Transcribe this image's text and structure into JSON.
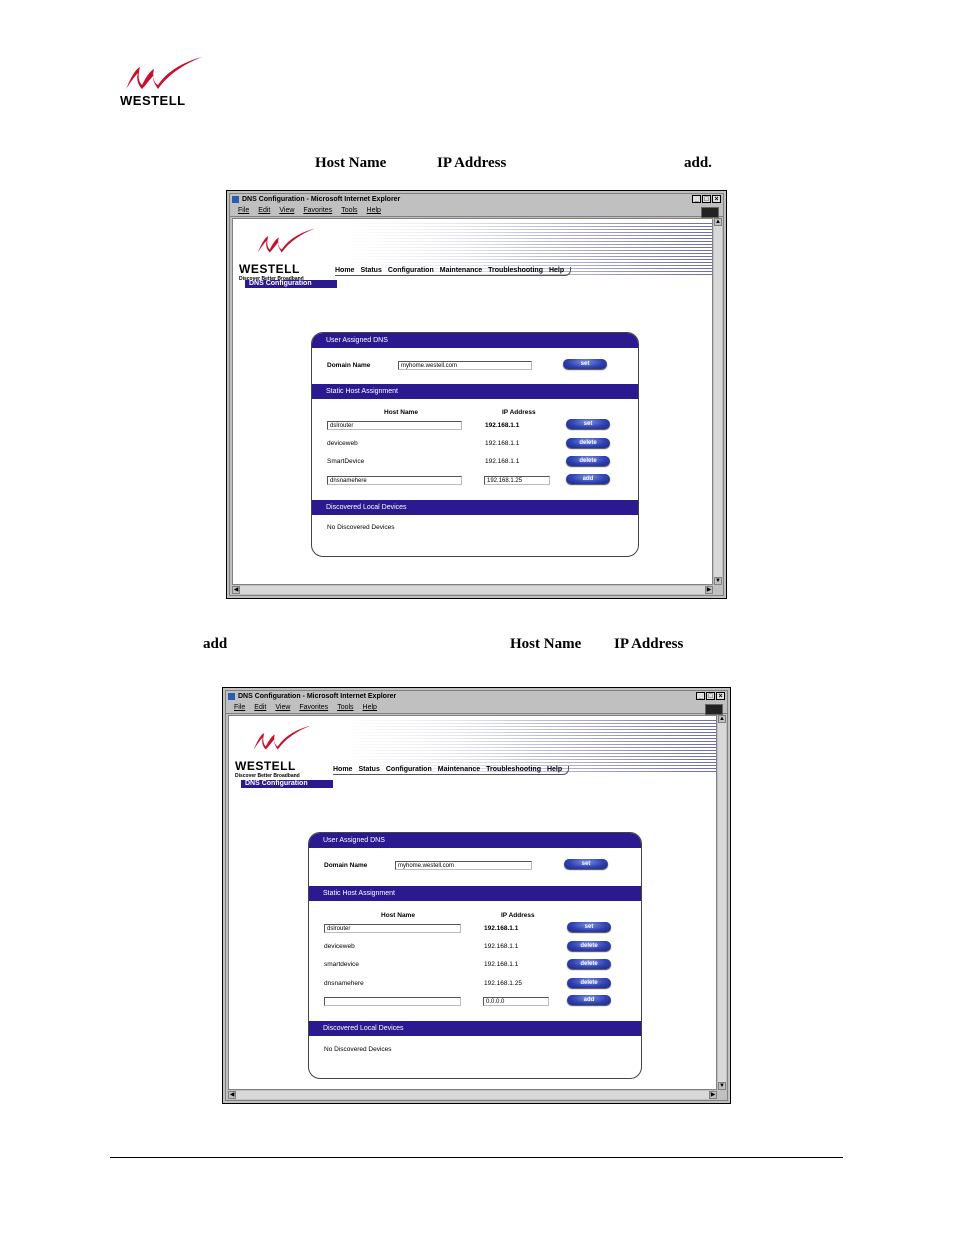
{
  "doc": {
    "logo_text": "WESTELL",
    "intro": {
      "host_name": "Host Name",
      "ip_address": "IP Address",
      "add": "add."
    },
    "para": {
      "add": "add",
      "host_name": "Host Name",
      "ip_address": "IP Address"
    }
  },
  "screen1": {
    "window_title": "DNS Configuration - Microsoft Internet Explorer",
    "menu": [
      "File",
      "Edit",
      "View",
      "Favorites",
      "Tools",
      "Help"
    ],
    "brand": {
      "name": "WESTELL",
      "tagline": "Discover  Better  Broadband"
    },
    "nav": [
      "Home",
      "Status",
      "Configuration",
      "Maintenance",
      "Troubleshooting",
      "Help"
    ],
    "page_title": "DNS Configuration",
    "user_dns": {
      "heading": "User Assigned DNS",
      "domain_label": "Domain Name",
      "domain_value": "myhome.westell.com",
      "set_label": "set"
    },
    "static": {
      "heading": "Static Host Assignment",
      "col_host": "Host Name",
      "col_ip": "IP Address",
      "rows": [
        {
          "host": "dslrouter",
          "ip": "192.168.1.1",
          "button": "set"
        },
        {
          "host": "deviceweb",
          "ip": "192.168.1.1",
          "button": "delete"
        },
        {
          "host": "SmartDevice",
          "ip": "192.168.1.1",
          "button": "delete"
        },
        {
          "host": "dnsnamehere",
          "ip": "192.168.1.25",
          "button": "add"
        }
      ]
    },
    "discovered": {
      "heading": "Discovered Local Devices",
      "text": "No Discovered Devices"
    }
  },
  "screen2": {
    "window_title": "DNS Configuration - Microsoft Internet Explorer",
    "menu": [
      "File",
      "Edit",
      "View",
      "Favorites",
      "Tools",
      "Help"
    ],
    "brand": {
      "name": "WESTELL",
      "tagline": "Discover  Better  Broadband"
    },
    "nav": [
      "Home",
      "Status",
      "Configuration",
      "Maintenance",
      "Troubleshooting",
      "Help"
    ],
    "page_title": "DNS Configuration",
    "user_dns": {
      "heading": "User Assigned DNS",
      "domain_label": "Domain Name",
      "domain_value": "myhome.westell.com",
      "set_label": "set"
    },
    "static": {
      "heading": "Static Host Assignment",
      "col_host": "Host Name",
      "col_ip": "IP Address",
      "rows": [
        {
          "host": "dslrouter",
          "ip": "192.168.1.1",
          "button": "set"
        },
        {
          "host": "deviceweb",
          "ip": "192.168.1.1",
          "button": "delete"
        },
        {
          "host": "smartdevice",
          "ip": "192.168.1.1",
          "button": "delete"
        },
        {
          "host": "dnsnamehere",
          "ip": "192.168.1.25",
          "button": "delete"
        },
        {
          "host": "",
          "ip": "0.0.0.0",
          "button": "add"
        }
      ]
    },
    "discovered": {
      "heading": "Discovered Local Devices",
      "text": "No Discovered Devices"
    }
  },
  "colors": {
    "band": "#2b1a8f",
    "button": "#3042b3",
    "logo_red": "#c8102e"
  }
}
